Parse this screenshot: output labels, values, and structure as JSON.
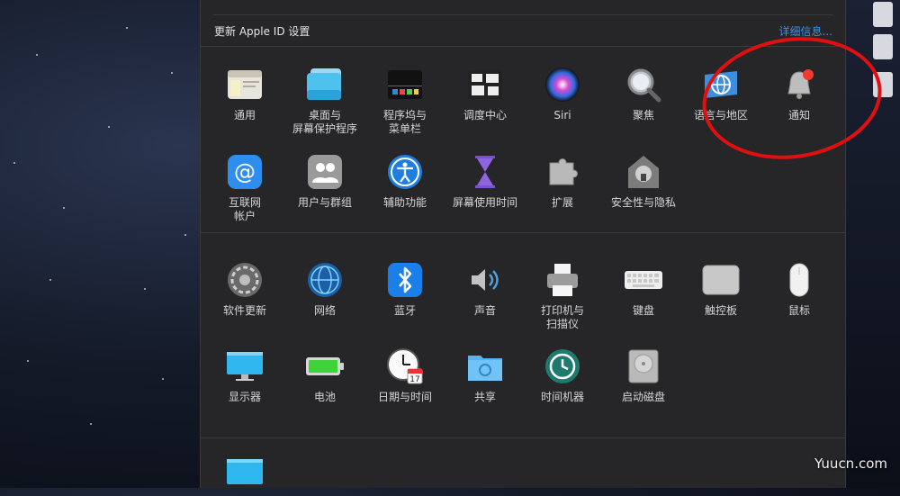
{
  "banner": {
    "title": "更新 Apple ID 设置",
    "link": "详细信息..."
  },
  "section1": [
    {
      "label": "通用",
      "icon": "general-icon"
    },
    {
      "label": "桌面与\n屏幕保护程序",
      "icon": "desktop-screensaver-icon"
    },
    {
      "label": "程序坞与\n菜单栏",
      "icon": "dock-icon"
    },
    {
      "label": "调度中心",
      "icon": "mission-control-icon"
    },
    {
      "label": "Siri",
      "icon": "siri-icon"
    },
    {
      "label": "聚焦",
      "icon": "spotlight-icon"
    },
    {
      "label": "语言与地区",
      "icon": "language-region-icon"
    },
    {
      "label": "通知",
      "icon": "notifications-icon"
    },
    {
      "label": "互联网\n帐户",
      "icon": "internet-accounts-icon"
    },
    {
      "label": "用户与群组",
      "icon": "users-groups-icon"
    },
    {
      "label": "辅助功能",
      "icon": "accessibility-icon"
    },
    {
      "label": "屏幕使用时间",
      "icon": "screen-time-icon"
    },
    {
      "label": "扩展",
      "icon": "extensions-icon"
    },
    {
      "label": "安全性与隐私",
      "icon": "security-privacy-icon"
    }
  ],
  "section2": [
    {
      "label": "软件更新",
      "icon": "software-update-icon"
    },
    {
      "label": "网络",
      "icon": "network-icon"
    },
    {
      "label": "蓝牙",
      "icon": "bluetooth-icon"
    },
    {
      "label": "声音",
      "icon": "sound-icon"
    },
    {
      "label": "打印机与\n扫描仪",
      "icon": "printers-scanners-icon"
    },
    {
      "label": "键盘",
      "icon": "keyboard-icon"
    },
    {
      "label": "触控板",
      "icon": "trackpad-icon"
    },
    {
      "label": "鼠标",
      "icon": "mouse-icon"
    },
    {
      "label": "显示器",
      "icon": "displays-icon"
    },
    {
      "label": "电池",
      "icon": "battery-icon"
    },
    {
      "label": "日期与时间",
      "icon": "date-time-icon",
      "calendar_day": "17"
    },
    {
      "label": "共享",
      "icon": "sharing-icon"
    },
    {
      "label": "时间机器",
      "icon": "time-machine-icon"
    },
    {
      "label": "启动磁盘",
      "icon": "startup-disk-icon"
    }
  ],
  "section3": [
    {
      "label": "",
      "icon": "display-extra-icon"
    }
  ],
  "watermark": "Yuucn.com",
  "colors": {
    "accent": "#3d8fe8",
    "highlight_circle": "#e01010",
    "panel": "#262628"
  }
}
